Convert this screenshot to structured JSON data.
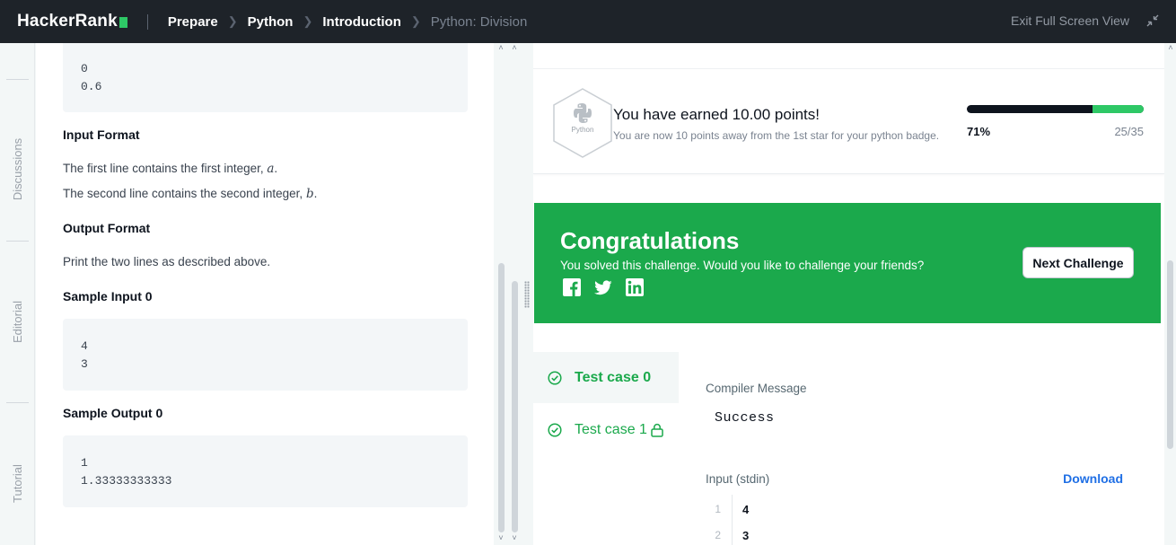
{
  "header": {
    "logo": "HackerRank",
    "breadcrumbs": [
      "Prepare",
      "Python",
      "Introduction",
      "Python: Division"
    ],
    "exit_label": "Exit Full Screen View"
  },
  "sidetabs": [
    "Discussions",
    "Editorial",
    "Tutorial"
  ],
  "problem": {
    "top_output": [
      "0",
      "0.6"
    ],
    "input_format_heading": "Input Format",
    "input_line1": "The first line contains the first integer, ",
    "input_var1": "a",
    "input_line2": "The second line contains the second integer, ",
    "input_var2": "b",
    "output_format_heading": "Output Format",
    "output_text": "Print the two lines as described above.",
    "sample_input_heading": "Sample Input 0",
    "sample_input": [
      "4",
      "3"
    ],
    "sample_output_heading": "Sample Output 0",
    "sample_output": [
      "1",
      "1.33333333333"
    ]
  },
  "points": {
    "badge_label": "Python",
    "title": "You have earned 10.00 points!",
    "subtitle": "You are now 10 points away from the 1st star for your python badge.",
    "progress_fraction": 0.71,
    "percent": "71%",
    "count": "25/35"
  },
  "congrats": {
    "title": "Congratulations",
    "subtitle": "You solved this challenge. Would you like to challenge your friends?",
    "next_button": "Next Challenge",
    "social": [
      "facebook-icon",
      "twitter-icon",
      "linkedin-icon"
    ]
  },
  "tests": {
    "items": [
      {
        "label": "Test case 0",
        "locked": false
      },
      {
        "label": "Test case 1",
        "locked": true
      }
    ]
  },
  "result": {
    "compiler_label": "Compiler Message",
    "compiler_message": "Success",
    "input_label": "Input (stdin)",
    "download_label": "Download",
    "input_lines": [
      {
        "num": "1",
        "value": "4"
      },
      {
        "num": "2",
        "value": "3"
      }
    ]
  },
  "colors": {
    "topbar": "#1e2329",
    "brand_green": "#2ec866",
    "success_green": "#1ba94c",
    "link_blue": "#1f6fe5"
  }
}
